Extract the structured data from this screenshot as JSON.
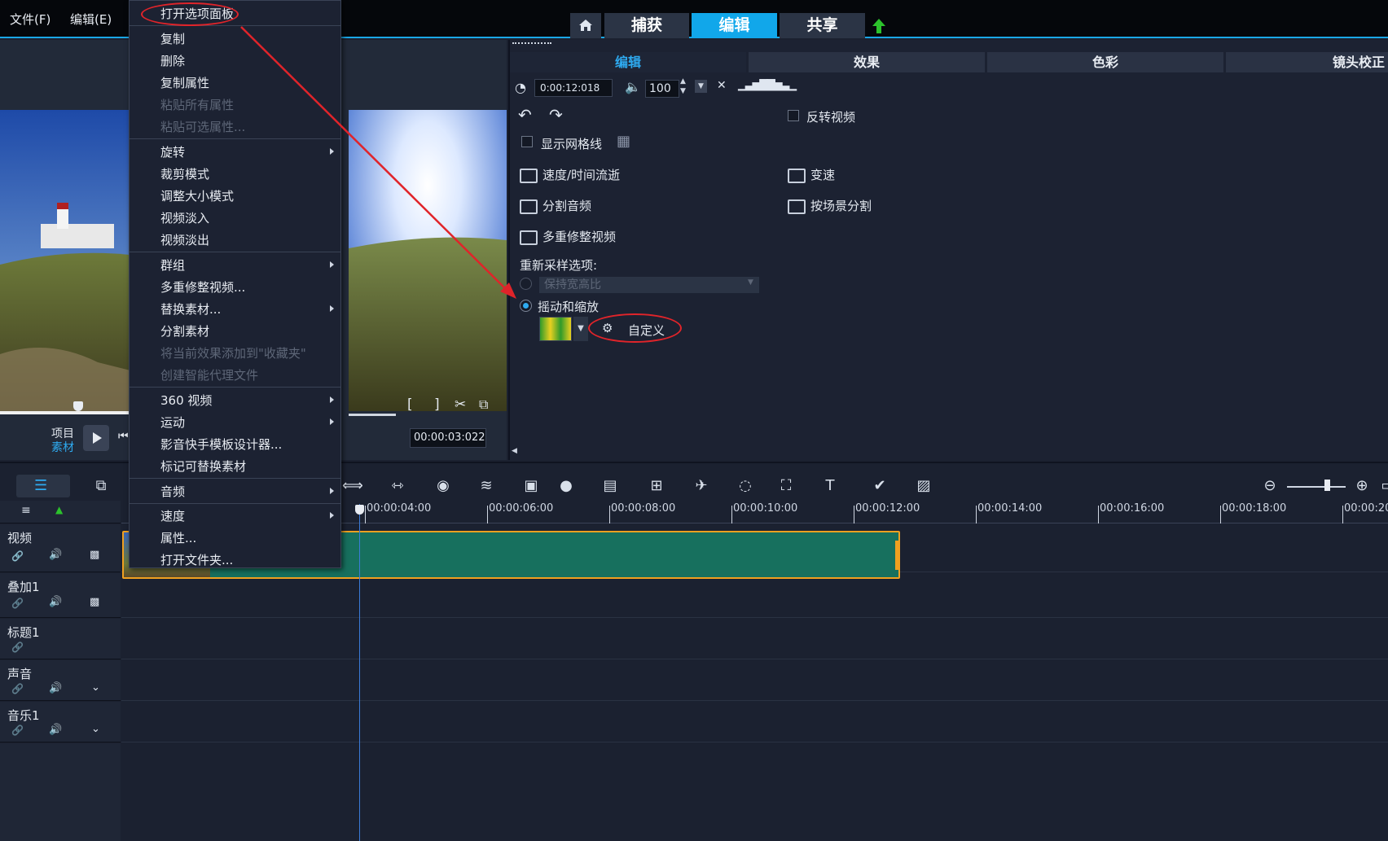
{
  "menubar": {
    "file": "文件(F)",
    "edit": "编辑(E)"
  },
  "modes": {
    "capture": "捕获",
    "edit": "编辑",
    "share": "共享"
  },
  "preview": {
    "project_label": "项目",
    "clip_label": "素材",
    "timecode": "00:00:03:022"
  },
  "options": {
    "tabs": [
      "编辑",
      "效果",
      "色彩",
      "镜头校正"
    ],
    "duration": "0:00:12:018",
    "volume": "100",
    "reverse_video": "反转视频",
    "show_grid": "显示网格线",
    "speed_time": "速度/时间流逝",
    "variable_speed": "变速",
    "split_audio": "分割音频",
    "split_by_scene": "按场景分割",
    "multi_trim": "多重修整视频",
    "resample_label": "重新采样选项:",
    "keep_aspect": "保持宽高比",
    "pan_zoom": "摇动和缩放",
    "customize": "自定义"
  },
  "context_menu": {
    "open_options": "打开选项面板",
    "copy": "复制",
    "delete": "删除",
    "copy_attributes": "复制属性",
    "paste_all": "粘贴所有属性",
    "paste_selected": "粘贴可选属性...",
    "rotate": "旋转",
    "crop_mode": "裁剪模式",
    "resize_mode": "调整大小模式",
    "fade_in": "视频淡入",
    "fade_out": "视频淡出",
    "group": "群组",
    "multi_trim": "多重修整视频...",
    "replace": "替换素材...",
    "split": "分割素材",
    "add_favorites": "将当前效果添加到\"收藏夹\"",
    "smart_proxy": "创建智能代理文件",
    "video_360": "360 视频",
    "motion": "运动",
    "template_designer": "影音快手模板设计器...",
    "mark_replaceable": "标记可替换素材",
    "audio": "音频",
    "speed": "速度",
    "properties": "属性...",
    "open_folder": "打开文件夹..."
  },
  "timeline": {
    "ticks": [
      "00:00:04:00",
      "00:00:06:00",
      "00:00:08:00",
      "00:00:10:00",
      "00:00:12:00",
      "00:00:14:00",
      "00:00:16:00",
      "00:00:18:00",
      "00:00:20"
    ],
    "tracks": {
      "video": "视频",
      "overlay": "叠加1",
      "title": "标题1",
      "voice": "声音",
      "music": "音乐1"
    }
  },
  "colors": {
    "accent": "#11a7ea",
    "clip": "#17705e",
    "clip_border": "#f0a020",
    "annotation": "#e0242a"
  }
}
